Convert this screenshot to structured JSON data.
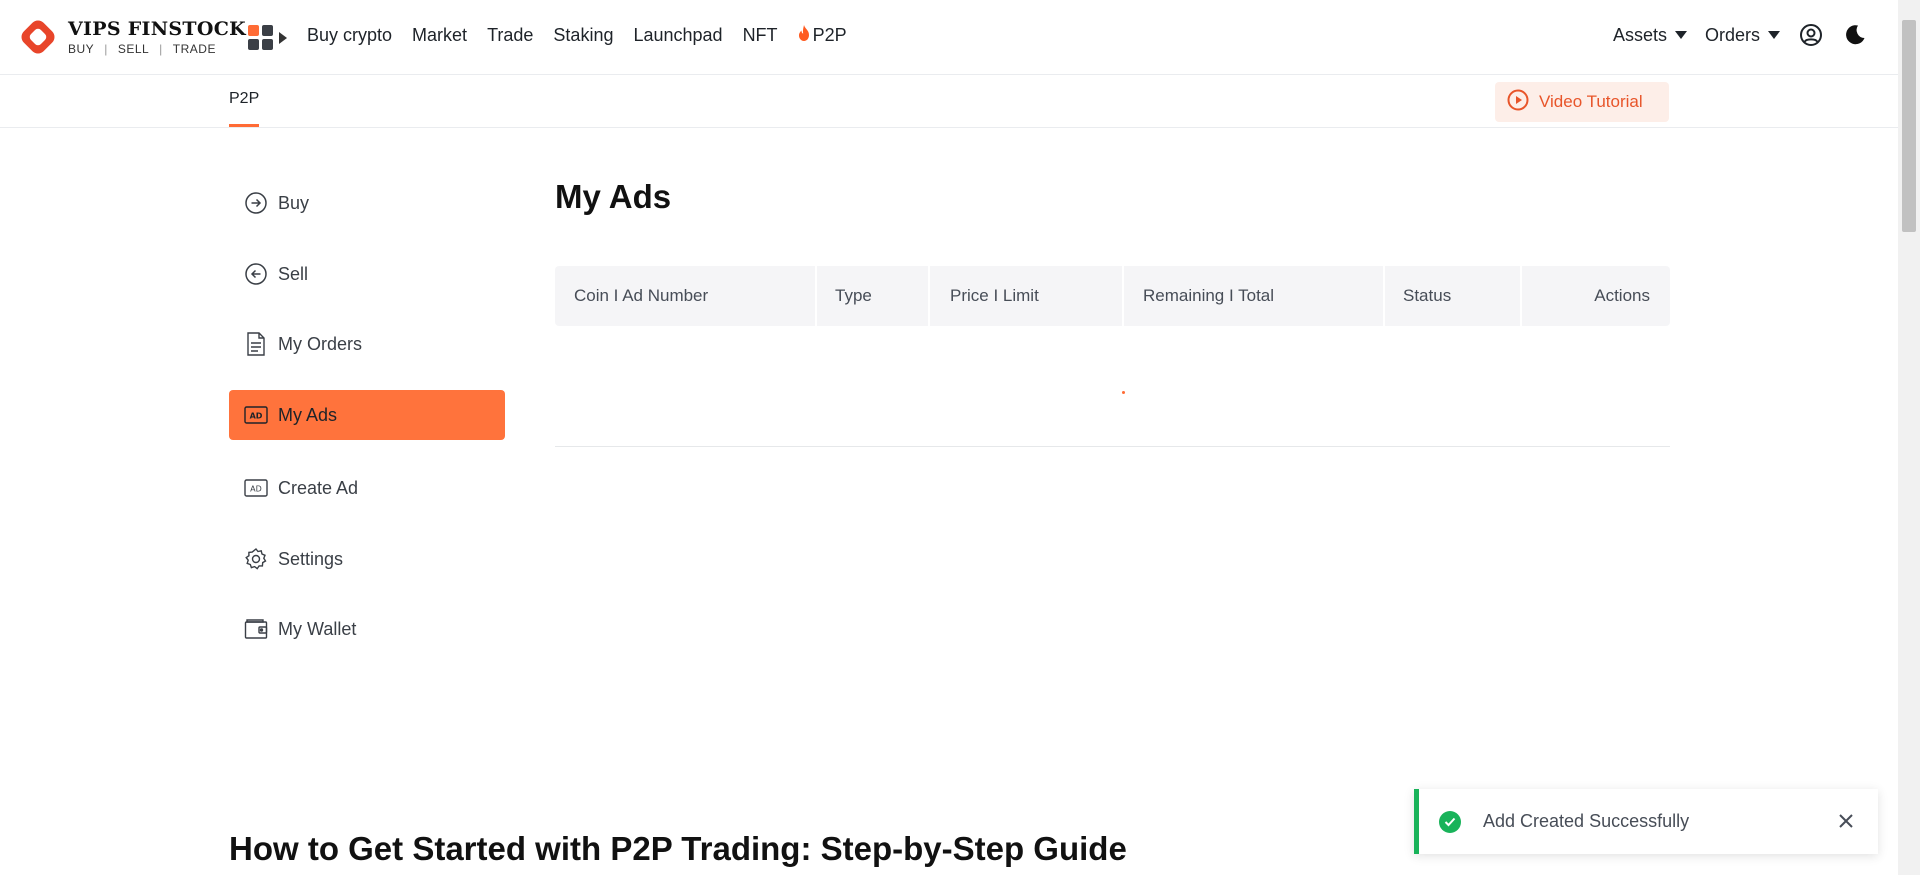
{
  "brand": {
    "name": "VIPS FINSTOCK",
    "tagline": [
      "BUY",
      "SELL",
      "TRADE"
    ],
    "accent": "#ff6b35"
  },
  "nav": {
    "apps_icon": "grid-icon",
    "links": [
      "Buy crypto",
      "Market",
      "Trade",
      "Staking",
      "Launchpad",
      "NFT",
      "P2P"
    ],
    "assets_label": "Assets",
    "orders_label": "Orders",
    "profile_icon": "user-circle-icon",
    "theme_icon": "moon-icon"
  },
  "subnav": {
    "tab": "P2P",
    "video_tutorial": "Video Tutorial"
  },
  "sidebar": {
    "items": [
      {
        "label": "Buy",
        "icon": "arrow-right-circle-icon"
      },
      {
        "label": "Sell",
        "icon": "arrow-left-circle-icon"
      },
      {
        "label": "My Orders",
        "icon": "document-icon"
      },
      {
        "label": "My Ads",
        "icon": "ad-icon",
        "active": true
      },
      {
        "label": "Create Ad",
        "icon": "ad-icon"
      },
      {
        "label": "Settings",
        "icon": "gear-icon"
      },
      {
        "label": "My Wallet",
        "icon": "wallet-icon"
      }
    ]
  },
  "main": {
    "title": "My Ads",
    "columns": [
      "Coin I Ad Number",
      "Type",
      "Price I Limit",
      "Remaining I Total",
      "Status",
      "Actions"
    ]
  },
  "guide": {
    "title": "How to Get Started with P2P Trading: Step-by-Step Guide"
  },
  "toast": {
    "message": "Add Created Successfully",
    "status_color": "#19b35a"
  }
}
